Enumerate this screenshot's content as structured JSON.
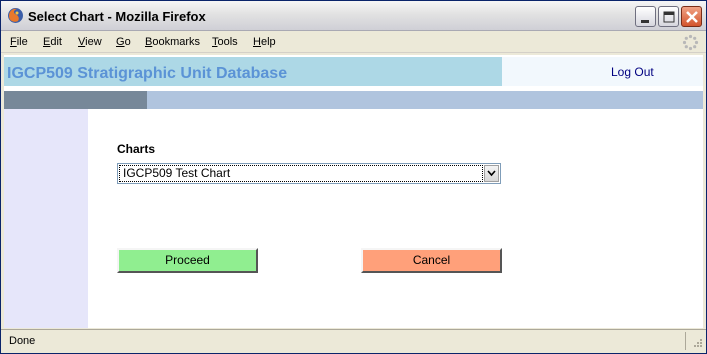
{
  "window": {
    "title": "Select Chart - Mozilla Firefox"
  },
  "menu": {
    "items": [
      {
        "accel": "F",
        "rest": "ile"
      },
      {
        "accel": "E",
        "rest": "dit"
      },
      {
        "accel": "V",
        "rest": "iew"
      },
      {
        "accel": "G",
        "rest": "o"
      },
      {
        "accel": "B",
        "rest": "ookmarks"
      },
      {
        "accel": "T",
        "rest": "ools"
      },
      {
        "accel": "H",
        "rest": "elp"
      }
    ]
  },
  "header": {
    "title": "IGCP509 Stratigraphic Unit Database",
    "logout": "Log Out"
  },
  "form": {
    "charts_label": "Charts",
    "chart_select_value": "IGCP509 Test Chart",
    "proceed_label": "Proceed",
    "cancel_label": "Cancel"
  },
  "status": {
    "text": "Done"
  },
  "icons": {
    "app": "firefox-icon",
    "throbber": "throbber-icon",
    "minimize": "minimize-icon",
    "maximize": "maximize-icon",
    "close": "close-icon",
    "dropdown": "chevron-down-icon",
    "grip": "resize-grip-icon"
  },
  "colors": {
    "header_band": "#add8e6",
    "header_title": "#5b93d6",
    "nav_dark": "#778899",
    "nav_light": "#b0c4de",
    "sidebar": "#e6e6fa",
    "proceed_button": "#90ee90",
    "cancel_button": "#ffa07a"
  }
}
